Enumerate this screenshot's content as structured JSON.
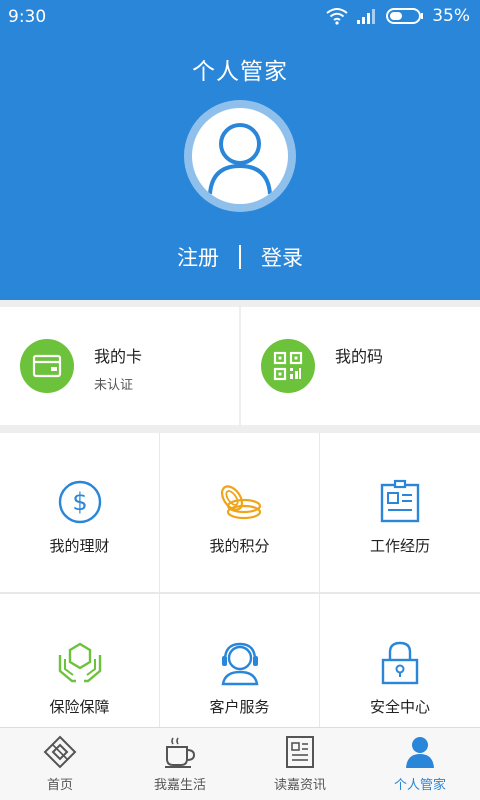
{
  "status": {
    "time": "9:30",
    "battery": "35%"
  },
  "header": {
    "title": "个人管家",
    "register": "注册",
    "login": "登录"
  },
  "cards": [
    {
      "label": "我的卡",
      "sub": "未认证",
      "icon": "card-icon"
    },
    {
      "label": "我的码",
      "sub": "",
      "icon": "qr-code-icon"
    }
  ],
  "grid": [
    {
      "label": "我的理财",
      "icon": "dollar-icon"
    },
    {
      "label": "我的积分",
      "icon": "coins-icon"
    },
    {
      "label": "工作经历",
      "icon": "id-badge-icon"
    },
    {
      "label": "保险保障",
      "icon": "insurance-icon"
    },
    {
      "label": "客户服务",
      "icon": "customer-service-icon"
    },
    {
      "label": "安全中心",
      "icon": "lock-icon"
    }
  ],
  "nav": [
    {
      "label": "首页",
      "icon": "home-diamond-icon",
      "active": false
    },
    {
      "label": "我嘉生活",
      "icon": "coffee-cup-icon",
      "active": false
    },
    {
      "label": "读嘉资讯",
      "icon": "newspaper-icon",
      "active": false
    },
    {
      "label": "个人管家",
      "icon": "person-icon",
      "active": true
    }
  ],
  "colors": {
    "primary": "#2a86d8",
    "green": "#6cc23a",
    "orange": "#f0a418"
  }
}
